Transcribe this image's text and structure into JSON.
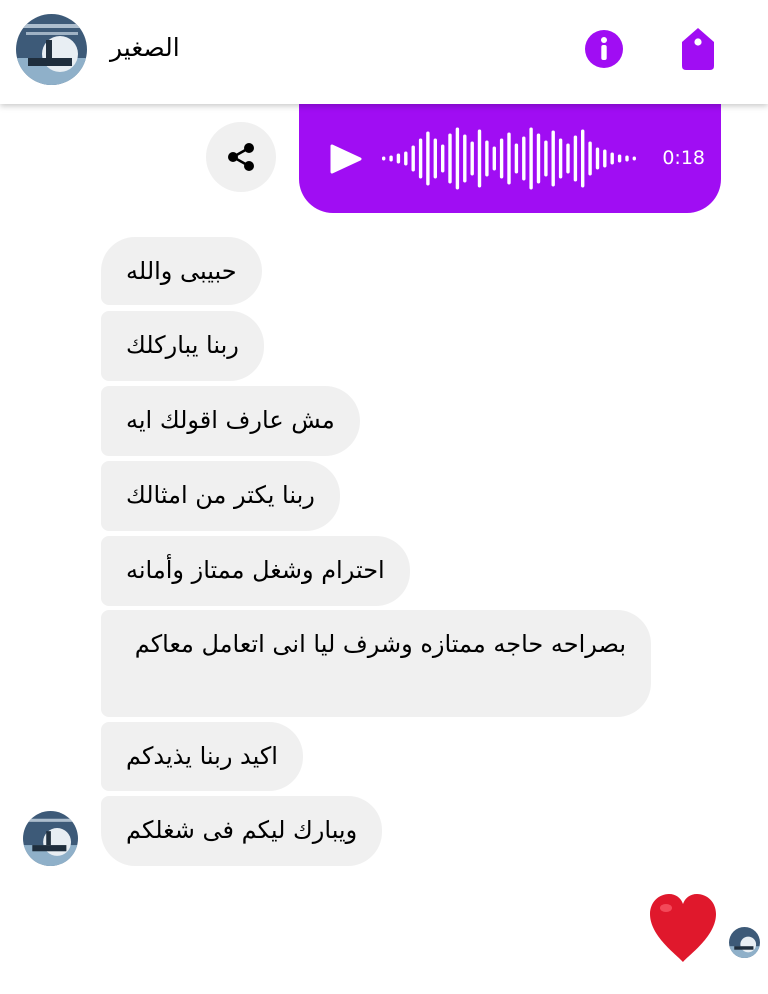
{
  "header": {
    "contact_name": "الصغير",
    "accent_color": "#a00df3"
  },
  "voice_message": {
    "duration": "0:18",
    "background_color": "#a00df3"
  },
  "messages": [
    {
      "text": "حبيبى والله"
    },
    {
      "text": "ربنا يباركلك"
    },
    {
      "text": "مش عارف اقولك ايه"
    },
    {
      "text": "ربنا يكتر من امثالك"
    },
    {
      "text": "احترام وشغل ممتاز وأمانه"
    },
    {
      "text": "بصراحه حاجه ممتازه وشرف ليا انى اتعامل معاكم"
    },
    {
      "text": "اكيد ربنا يذيدكم"
    },
    {
      "text": "ويبارك ليكم فى شغلكم"
    }
  ],
  "reaction": {
    "emoji": "heart",
    "color": "#e0182c"
  },
  "icons": [
    "info-icon",
    "tag-icon",
    "share-icon",
    "play-icon",
    "heart-icon"
  ]
}
